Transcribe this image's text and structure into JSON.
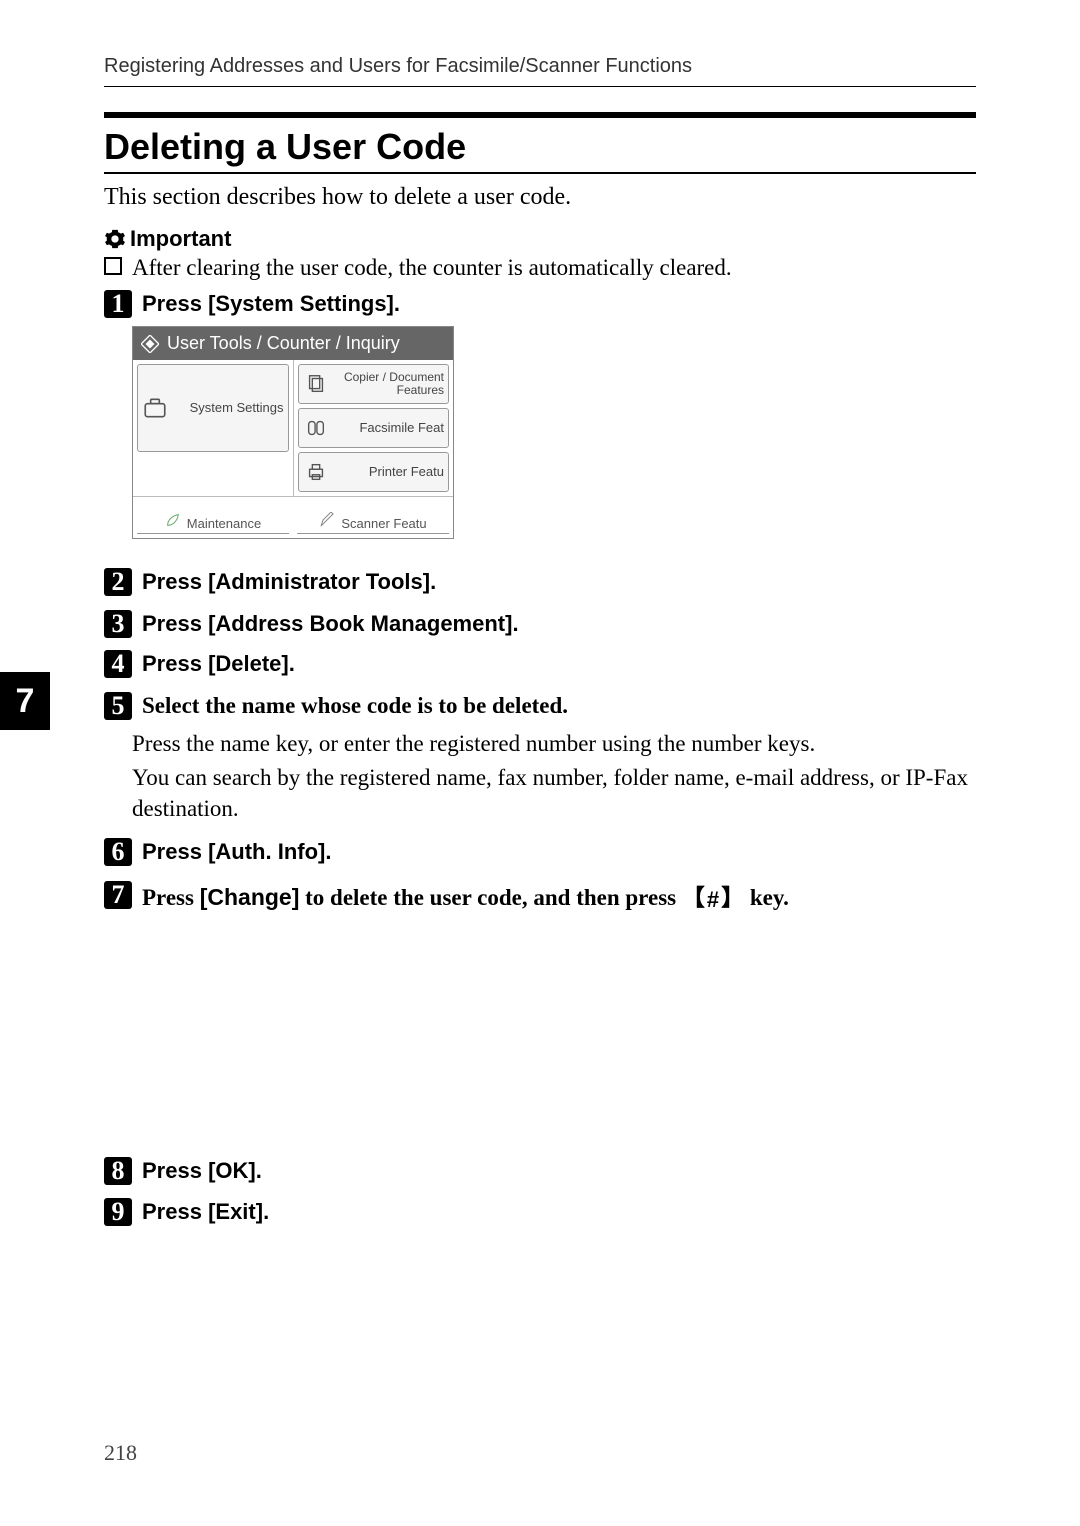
{
  "header": "Registering Addresses and Users for Facsimile/Scanner Functions",
  "title": "Deleting a User Code",
  "intro": "This section describes how to delete a user code.",
  "important_label": "Important",
  "important_text": "After clearing the user code, the counter is automatically cleared.",
  "steps": {
    "s1": {
      "num": "1",
      "pre": "Press ",
      "btn": "[System Settings]",
      "post": "."
    },
    "s2": {
      "num": "2",
      "pre": "Press ",
      "btn": "[Administrator Tools]",
      "post": "."
    },
    "s3": {
      "num": "3",
      "pre": "Press ",
      "btn": "[Address Book Management]",
      "post": "."
    },
    "s4": {
      "num": "4",
      "pre": "Press ",
      "btn": "[Delete]",
      "post": "."
    },
    "s5": {
      "num": "5",
      "text": "Select the name whose code is to be deleted."
    },
    "s6": {
      "num": "6",
      "pre": "Press ",
      "btn": "[Auth. Info]",
      "post": "."
    },
    "s7": {
      "num": "7",
      "pre": "Press ",
      "btn": "[Change]",
      "mid": " to delete the user code, and then press ",
      "key": "#",
      "post": " key."
    },
    "s8": {
      "num": "8",
      "pre": "Press ",
      "btn": "[OK]",
      "post": "."
    },
    "s9": {
      "num": "9",
      "pre": "Press ",
      "btn": "[Exit]",
      "post": "."
    }
  },
  "paras": {
    "p1": "Press the name key, or enter the registered number using the number keys.",
    "p2": "You can search by the registered name, fax number, folder name, e-mail address, or IP-Fax destination."
  },
  "screenshot": {
    "title": "User Tools / Counter / Inquiry",
    "system_settings": "System Settings",
    "copier": "Copier / Document Features",
    "fax": "Facsimile Feat",
    "printer": "Printer Featu",
    "maintenance": "Maintenance",
    "scanner": "Scanner Featu"
  },
  "side_tab": "7",
  "page_number": "218"
}
